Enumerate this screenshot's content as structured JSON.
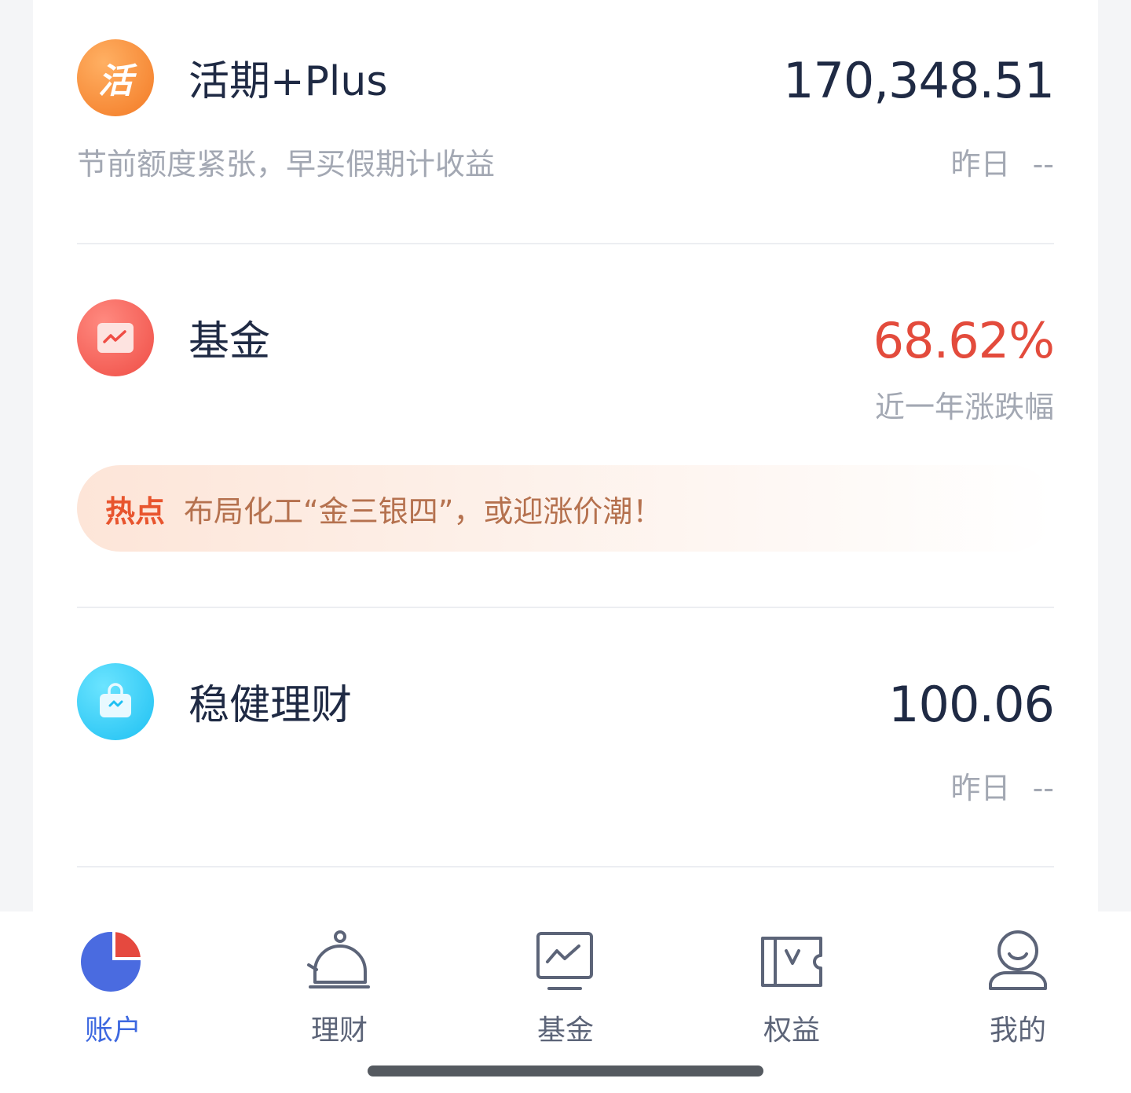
{
  "products": [
    {
      "title": "活期+Plus",
      "icon_glyph": "活",
      "icon_name": "huoqi-icon",
      "value": "170,348.51",
      "subtitle": "节前额度紧张，早买假期计收益",
      "sub_right_label": "昨日",
      "sub_right_value": "--"
    },
    {
      "title": "基金",
      "icon_name": "fund-chart-icon",
      "value": "68.62%",
      "value_color": "#e34b3c",
      "sub_right_label": "近一年涨跌幅"
    },
    {
      "title": "稳健理财",
      "icon_name": "steady-wealth-bag-icon",
      "value": "100.06",
      "sub_right_label": "昨日",
      "sub_right_value": "--"
    }
  ],
  "hot_banner": {
    "tag": "热点",
    "text": "布局化工“金三银四”，或迎涨价潮！"
  },
  "tabbar": {
    "tabs": [
      {
        "label": "账户",
        "icon": "account-pie-icon",
        "active": true
      },
      {
        "label": "理财",
        "icon": "wealth-bell-icon",
        "active": false
      },
      {
        "label": "基金",
        "icon": "fund-monitor-icon",
        "active": false
      },
      {
        "label": "权益",
        "icon": "benefit-ticket-icon",
        "active": false
      },
      {
        "label": "我的",
        "icon": "profile-user-icon",
        "active": false
      }
    ]
  },
  "colors": {
    "primary_text": "#1f2a44",
    "secondary_text": "#a3a8b3",
    "accent_blue": "#3d68e0",
    "rise_red": "#e34b3c",
    "hot_orange": "#e8552e"
  }
}
